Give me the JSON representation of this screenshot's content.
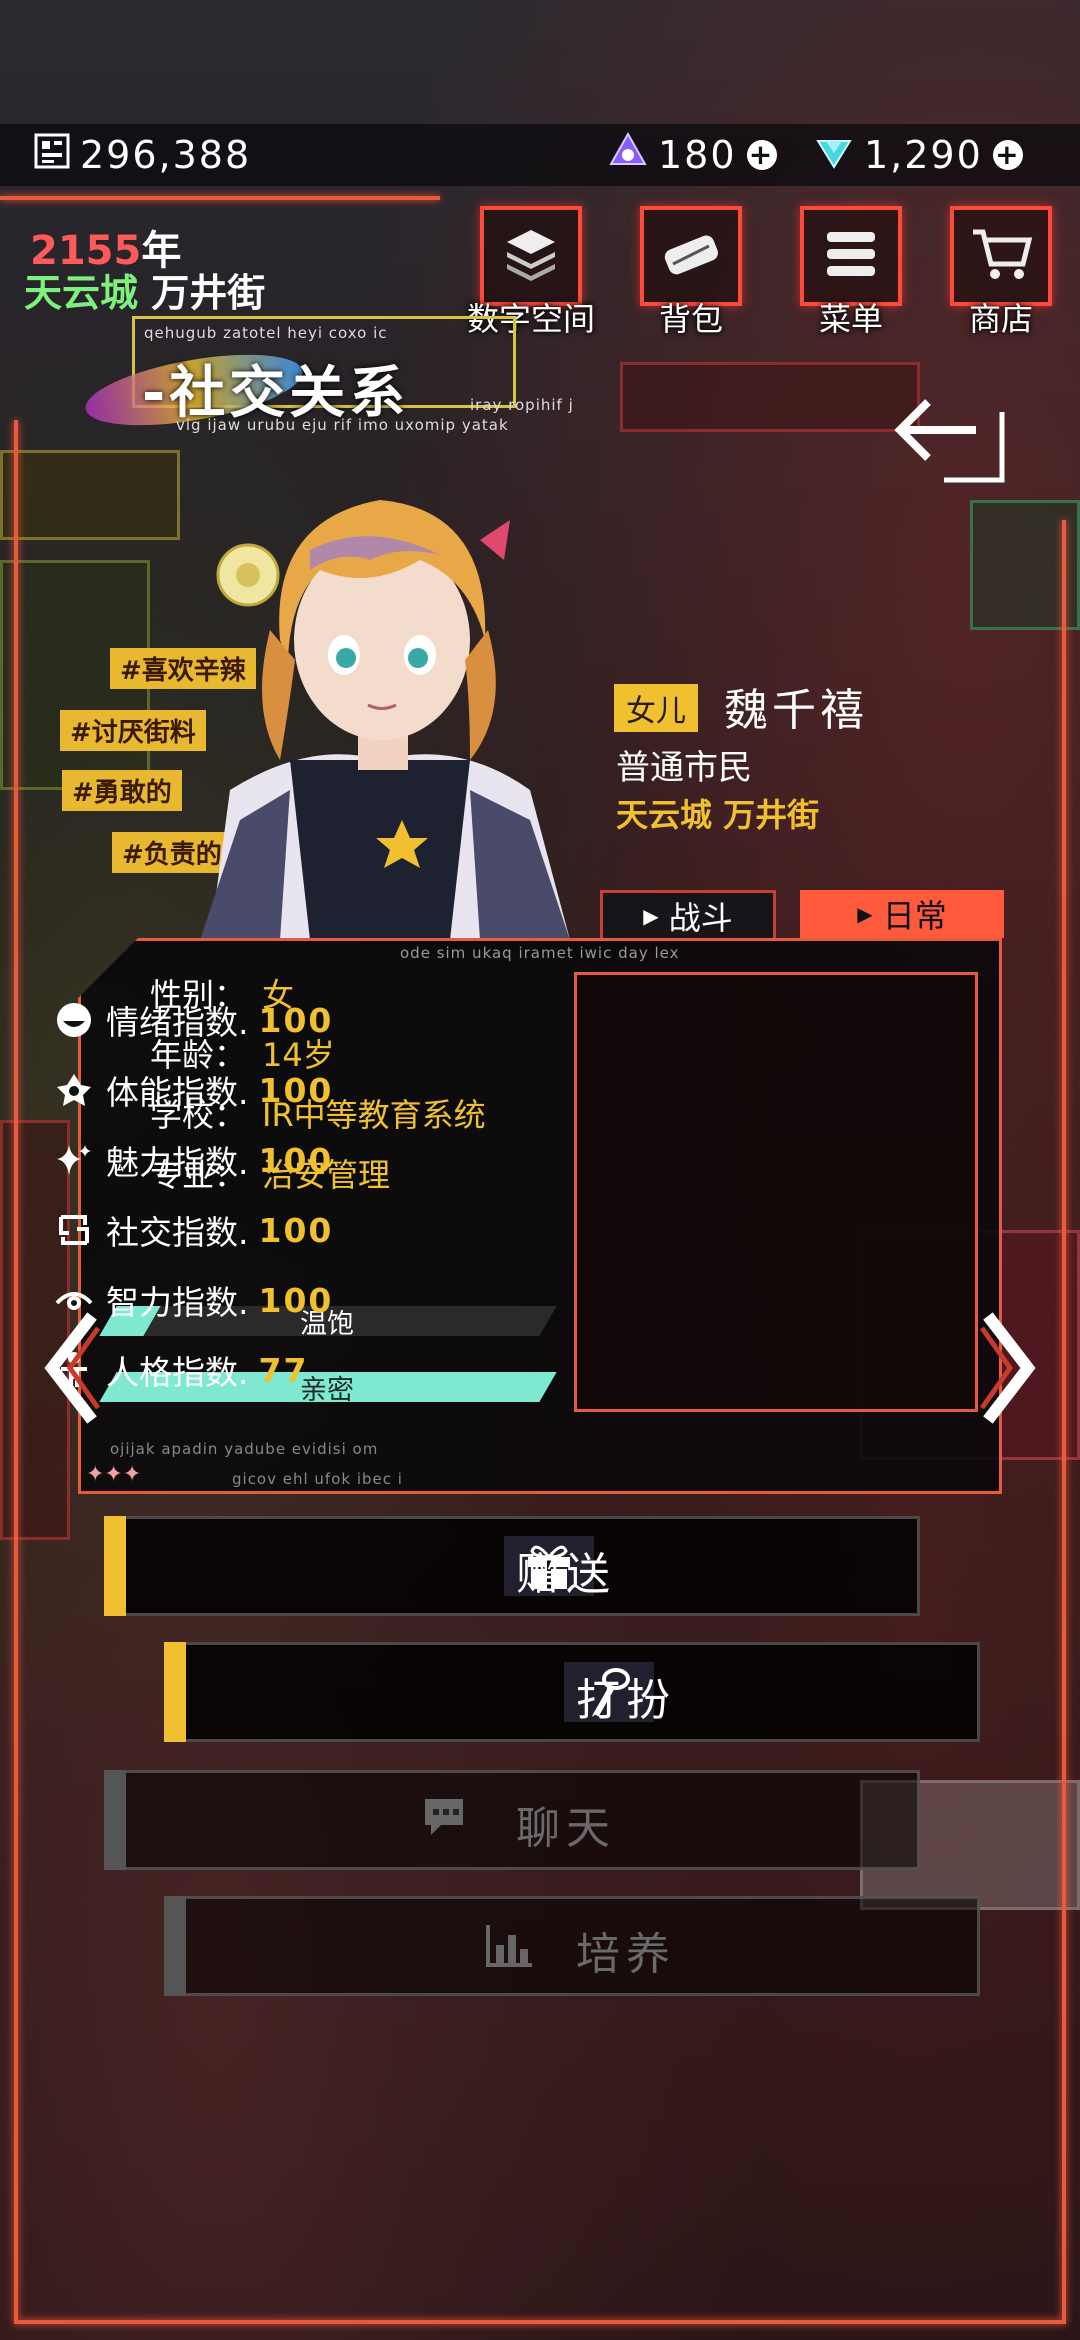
{
  "currency": {
    "credits": "296,388",
    "gems_purple": "180",
    "gems_blue": "1,290"
  },
  "header": {
    "year_number": "2155",
    "year_suffix": "年",
    "city": "天云城",
    "street": "万井街"
  },
  "nav": [
    {
      "label": "数字空间",
      "icon": "layers-icon"
    },
    {
      "label": "背包",
      "icon": "bag-icon"
    },
    {
      "label": "菜单",
      "icon": "list-icon"
    },
    {
      "label": "商店",
      "icon": "cart-icon"
    }
  ],
  "title": {
    "text": "-社交关系",
    "deco_top": "qehugub zatotel heyi coxo ic",
    "deco_bottom": "vig ijaw urubu eju rif imo uxomip yatak",
    "deco_right": "iray ropihif j"
  },
  "tags": [
    "#喜欢辛辣",
    "#讨厌街料",
    "#勇敢的",
    "#负责的"
  ],
  "character": {
    "relation": "女儿",
    "name": "魏千禧",
    "occupation": "普通市民",
    "home": "天云城 万井街"
  },
  "tabs": {
    "battle": "战斗",
    "daily": "日常",
    "active": "daily"
  },
  "panel": {
    "deco_top": "ode sim ukaq iramet iwic day lex",
    "deco_bottom_1": "ojijak apadin yadube evidisi om",
    "deco_bottom_2": "gicov ehl ufok ibec i",
    "info": [
      {
        "key": "性别：",
        "value": "女"
      },
      {
        "key": "年龄：",
        "value": "14岁"
      },
      {
        "key": "学校：",
        "value": "IR中等教育系统"
      },
      {
        "key": "专业：",
        "value": "治安管理"
      }
    ],
    "bars": [
      {
        "label": "温饱",
        "fill": 0.1
      },
      {
        "label": "亲密",
        "fill": 1.0
      }
    ],
    "stats": [
      {
        "label": "情绪指数.",
        "value": "100",
        "icon": "mood-icon"
      },
      {
        "label": "体能指数.",
        "value": "100",
        "icon": "stamina-icon"
      },
      {
        "label": "魅力指数.",
        "value": "100",
        "icon": "sparkle-icon"
      },
      {
        "label": "社交指数.",
        "value": "100",
        "icon": "social-icon"
      },
      {
        "label": "智力指数.",
        "value": "100",
        "icon": "eye-icon"
      },
      {
        "label": "人格指数.",
        "value": "77",
        "icon": "person-icon"
      }
    ]
  },
  "actions": [
    {
      "label": "赠送",
      "icon": "gift-icon",
      "enabled": true
    },
    {
      "label": "打扮",
      "icon": "brush-icon",
      "enabled": true
    },
    {
      "label": "聊天",
      "icon": "chat-icon",
      "enabled": false
    },
    {
      "label": "培养",
      "icon": "chart-icon",
      "enabled": false
    }
  ],
  "colors": {
    "accent_red": "#e85a3c",
    "accent_yellow": "#f0c030",
    "bar_fill": "#7fe8d0",
    "city_green": "#7df07d"
  }
}
